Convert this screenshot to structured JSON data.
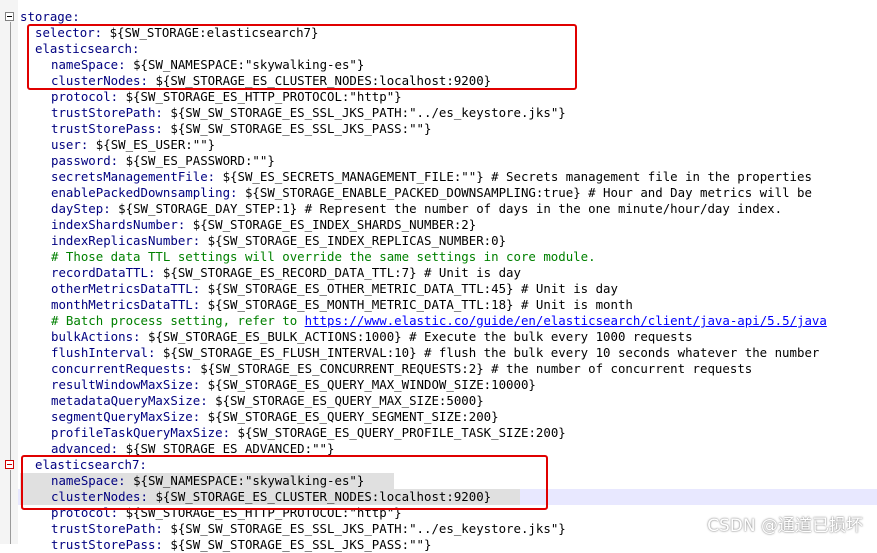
{
  "editor": {
    "lines": [
      {
        "indent": 0,
        "key": "storage:",
        "val": ""
      },
      {
        "indent": 1,
        "key": "selector:",
        "val": " ${SW_STORAGE:elasticsearch7}"
      },
      {
        "indent": 1,
        "key": "elasticsearch:",
        "val": ""
      },
      {
        "indent": 2,
        "key": "nameSpace:",
        "val": " ${SW_NAMESPACE:\"skywalking-es\"}"
      },
      {
        "indent": 2,
        "key": "clusterNodes:",
        "val": " ${SW_STORAGE_ES_CLUSTER_NODES:localhost:9200}"
      },
      {
        "indent": 2,
        "key": "protocol:",
        "val": " ${SW_STORAGE_ES_HTTP_PROTOCOL:\"http\"}"
      },
      {
        "indent": 2,
        "key": "trustStorePath:",
        "val": " ${SW_SW_STORAGE_ES_SSL_JKS_PATH:\"../es_keystore.jks\"}"
      },
      {
        "indent": 2,
        "key": "trustStorePass:",
        "val": " ${SW_SW_STORAGE_ES_SSL_JKS_PASS:\"\"}"
      },
      {
        "indent": 2,
        "key": "user:",
        "val": " ${SW_ES_USER:\"\"}"
      },
      {
        "indent": 2,
        "key": "password:",
        "val": " ${SW_ES_PASSWORD:\"\"}"
      },
      {
        "indent": 2,
        "key": "secretsManagementFile:",
        "val": " ${SW_ES_SECRETS_MANAGEMENT_FILE:\"\"} # Secrets management file in the properties"
      },
      {
        "indent": 2,
        "key": "enablePackedDownsampling:",
        "val": " ${SW_STORAGE_ENABLE_PACKED_DOWNSAMPLING:true} # Hour and Day metrics will be"
      },
      {
        "indent": 2,
        "key": "dayStep:",
        "val": " ${SW_STORAGE_DAY_STEP:1} # Represent the number of days in the one minute/hour/day index."
      },
      {
        "indent": 2,
        "key": "indexShardsNumber:",
        "val": " ${SW_STORAGE_ES_INDEX_SHARDS_NUMBER:2}"
      },
      {
        "indent": 2,
        "key": "indexReplicasNumber:",
        "val": " ${SW_STORAGE_ES_INDEX_REPLICAS_NUMBER:0}"
      },
      {
        "indent": 2,
        "key": "",
        "val": "",
        "comment": "# Those data TTL settings will override the same settings in core module."
      },
      {
        "indent": 2,
        "key": "recordDataTTL:",
        "val": " ${SW_STORAGE_ES_RECORD_DATA_TTL:7} # Unit is day"
      },
      {
        "indent": 2,
        "key": "otherMetricsDataTTL:",
        "val": " ${SW_STORAGE_ES_OTHER_METRIC_DATA_TTL:45} # Unit is day"
      },
      {
        "indent": 2,
        "key": "monthMetricsDataTTL:",
        "val": " ${SW_STORAGE_ES_MONTH_METRIC_DATA_TTL:18} # Unit is month"
      },
      {
        "indent": 2,
        "key": "",
        "val": "",
        "comment": "# Batch process setting, refer to ",
        "link": "https://www.elastic.co/guide/en/elasticsearch/client/java-api/5.5/java"
      },
      {
        "indent": 2,
        "key": "bulkActions:",
        "val": " ${SW_STORAGE_ES_BULK_ACTIONS:1000} # Execute the bulk every 1000 requests"
      },
      {
        "indent": 2,
        "key": "flushInterval:",
        "val": " ${SW_STORAGE_ES_FLUSH_INTERVAL:10} # flush the bulk every 10 seconds whatever the number"
      },
      {
        "indent": 2,
        "key": "concurrentRequests:",
        "val": " ${SW_STORAGE_ES_CONCURRENT_REQUESTS:2} # the number of concurrent requests"
      },
      {
        "indent": 2,
        "key": "resultWindowMaxSize:",
        "val": " ${SW_STORAGE_ES_QUERY_MAX_WINDOW_SIZE:10000}"
      },
      {
        "indent": 2,
        "key": "metadataQueryMaxSize:",
        "val": " ${SW_STORAGE_ES_QUERY_MAX_SIZE:5000}"
      },
      {
        "indent": 2,
        "key": "segmentQueryMaxSize:",
        "val": " ${SW_STORAGE_ES_QUERY_SEGMENT_SIZE:200}"
      },
      {
        "indent": 2,
        "key": "profileTaskQueryMaxSize:",
        "val": " ${SW_STORAGE_ES_QUERY_PROFILE_TASK_SIZE:200}"
      },
      {
        "indent": 2,
        "key": "advanced:",
        "val": " ${SW_STORAGE_ES_ADVANCED:\"\"}"
      },
      {
        "indent": 1,
        "key": "elasticsearch7:",
        "val": ""
      },
      {
        "indent": 2,
        "key": "nameSpace:",
        "val": " ${SW_NAMESPACE:\"skywalking-es\"}"
      },
      {
        "indent": 2,
        "key": "clusterNodes:",
        "val": " ${SW_STORAGE_ES_CLUSTER_NODES:localhost:9200}"
      },
      {
        "indent": 2,
        "key": "protocol:",
        "val": " ${SW_STORAGE_ES_HTTP_PROTOCOL:\"http\"}"
      },
      {
        "indent": 2,
        "key": "trustStorePath:",
        "val": " ${SW_SW_STORAGE_ES_SSL_JKS_PATH:\"../es_keystore.jks\"}"
      },
      {
        "indent": 2,
        "key": "trustStorePass:",
        "val": " ${SW_SW_STORAGE_ES_SSL_JKS_PASS:\"\"}"
      }
    ]
  },
  "watermark": "CSDN @通道已损坏",
  "colors": {
    "key": "#000080",
    "comment": "#008000",
    "link": "#0000ff",
    "annotation_box": "#e00000",
    "selection": "#e0e0e0"
  }
}
